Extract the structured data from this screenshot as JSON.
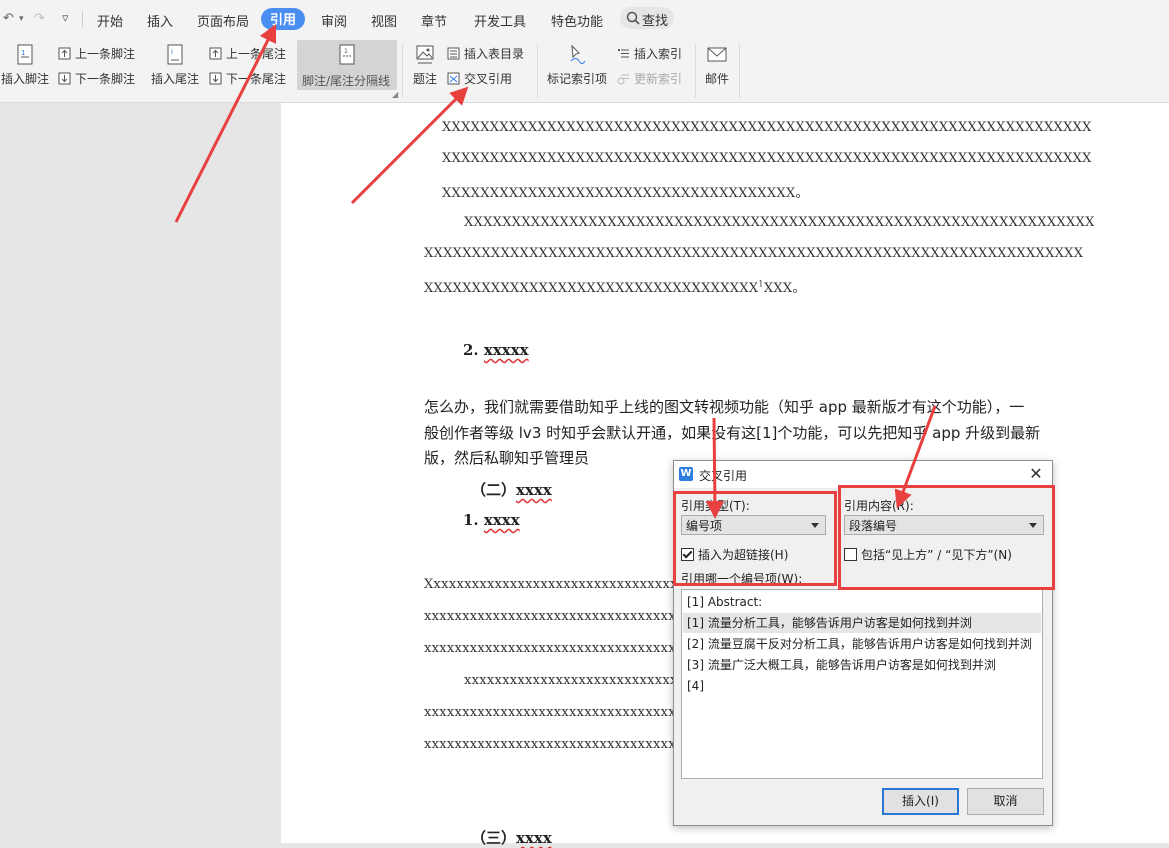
{
  "quick_access": {
    "undo": "↶",
    "undo_dropdown": "▾",
    "redo": "↷",
    "customize": "▿"
  },
  "menu": {
    "tabs": [
      {
        "label": "开始"
      },
      {
        "label": "插入"
      },
      {
        "label": "页面布局"
      },
      {
        "label": "引用"
      },
      {
        "label": "审阅"
      },
      {
        "label": "视图"
      },
      {
        "label": "章节"
      },
      {
        "label": "开发工具"
      },
      {
        "label": "特色功能"
      }
    ],
    "active_tab": "引用",
    "search_label": "查找"
  },
  "ribbon": {
    "insert_footnote": "插入脚注",
    "prev_footnote": "上一条脚注",
    "next_footnote": "下一条脚注",
    "insert_endnote": "插入尾注",
    "prev_endnote": "上一条尾注",
    "next_endnote": "下一条尾注",
    "note_separator": "脚注/尾注分隔线",
    "caption": "题注",
    "insert_table_of_figures": "插入表目录",
    "cross_reference": "交叉引用",
    "mark_index_entry": "标记索引项",
    "insert_index": "插入索引",
    "update_index": "更新索引",
    "mail": "邮件"
  },
  "document": {
    "para1": [
      "XXXXXXXXXXXXXXXXXXXXXXXXXXXXXXXXXXXXXXXXXXXXXXXXXXXXXXXXXXXXXXXXXXXX",
      "XXXXXXXXXXXXXXXXXXXXXXXXXXXXXXXXXXXXXXXXXXXXXXXXXXXXXXXXXXXXXXXXXXXX",
      "XXXXXXXXXXXXXXXXXXXXXXXXXXXXXXXXXXXXX。"
    ],
    "para2": [
      "XXXXXXXXXXXXXXXXXXXXXXXXXXXXXXXXXXXXXXXXXXXXXXXXXXXXXXXXXXXXXXXXXX",
      "XXXXXXXXXXXXXXXXXXXXXXXXXXXXXXXXXXXXXXXXXXXXXXXXXXXXXXXXXXXXXXXXXXXXX",
      "XXXXXXXXXXXXXXXXXXXXXXXXXXXXXXXXXXX"
    ],
    "para2_superscript": "1",
    "para2_tail": "XXX。",
    "heading_2_num": "2. ",
    "heading_2": "xxxxx",
    "cjk_para": [
      "怎么办，我们就需要借助知乎上线的图文转视频功能（知乎 app 最新版才有这个功能），一",
      "般创作者等级 lv3 时知乎会默认开通，如果没有这[1]个功能，可以先把知乎 app 升级到最新",
      "版，然后私聊知乎管理员"
    ],
    "sub_heading_1_num": "（二）",
    "sub_heading_1": "xxxx",
    "heading_1_num": "1. ",
    "heading_1": "xxxx",
    "para3": [
      "Xxxxxxxxxxxxxxxxxxxxxxxxxxxxxxxxxxxxxxxxxxxxxxxxxxxxxxxxxxxxxxxxxxx",
      "xxxxxxxxxxxxxxxxxxxxxxxxxxxxxxxxxxxxxxxxxxxxxxxxxxxxxxxxxxxxxxxxxxxx",
      "xxxxxxxxxxxxxxxxxxxxxxxxxxxxxxxxxxxxxxxxxxxxxxxxxxxxxxxxxxxxxxxxxxxx"
    ],
    "para4": [
      "xxxxxxxxxxxxxxxxxxxxxxxxxxxxxxxxxxxxxxxxxxxxxxxxxxxxxxxxxxxxxxxxxxx",
      "xxxxxxxxxxxxxxxxxxxxxxxxxxxxxxxxxxxxxxxxxxxxxxxxxxxxxxxxxxxxxxxxxxxx",
      "xxxxxxxxxxxxxxxxxxxxxxxxxxxxxxxxxxxxxxxxxxxxxxxxxxxxxxxxxxxxxxxxxxxx"
    ],
    "bottom_heading_num": "（三）",
    "bottom_heading": "xxxx",
    "paragraph_marker": "▤ ▾"
  },
  "dialog": {
    "title": "交叉引用",
    "close": "✕",
    "reference_type_label": "引用类型(T):",
    "reference_type_value": "编号项",
    "reference_content_label": "引用内容(R):",
    "reference_content_value": "段落编号",
    "insert_hyperlink_label": "插入为超链接(H)",
    "insert_hyperlink_checked": true,
    "include_above_below_label": "包括“见上方” / “见下方”(N)",
    "include_above_below_checked": false,
    "which_item_label": "引用哪一个编号项(W):",
    "items": [
      "[1] Abstract:",
      "[1] 流量分析工具，能够告诉用户访客是如何找到并浏",
      "[2] 流量豆腐干反对分析工具，能够告诉用户访客是如何找到并浏",
      "[3] 流量广泛大概工具，能够告诉用户访客是如何找到并浏",
      "[4]"
    ],
    "selected_index": 1,
    "insert_button": "插入(I)",
    "cancel_button": "取消"
  },
  "annotation_color": "#e8403f",
  "accent_color": "#4a8ef2"
}
